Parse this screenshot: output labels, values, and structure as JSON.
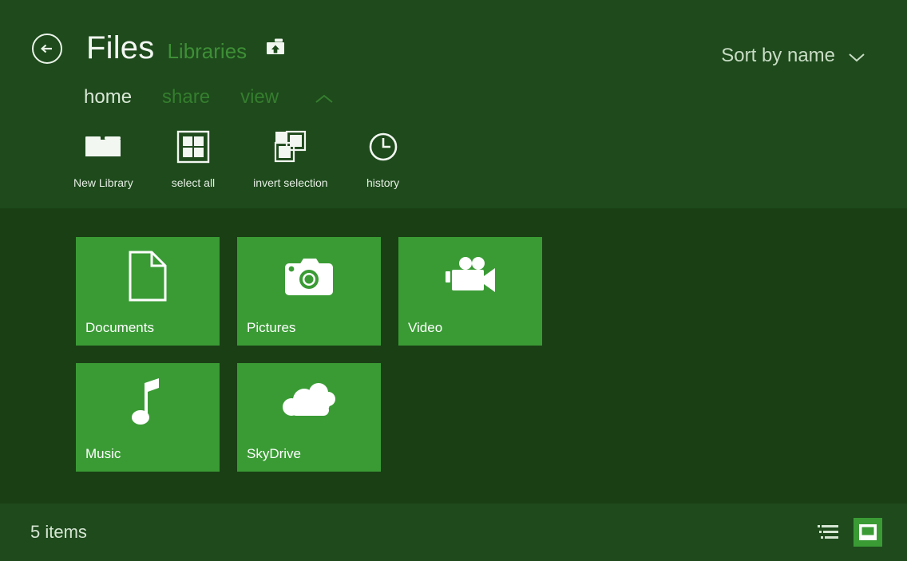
{
  "window": {
    "app_title": "Files",
    "breadcrumb_location": "Libraries",
    "back_icon": "back-arrow-circle-icon",
    "up_level_icon": "up-one-level-icon"
  },
  "sort": {
    "label": "Sort by name",
    "chevron_icon": "chevron-down-icon"
  },
  "tabs": [
    {
      "label": "home",
      "active": true
    },
    {
      "label": "share",
      "active": false
    },
    {
      "label": "view",
      "active": false
    }
  ],
  "ribbon_collapse_icon": "chevron-up-icon",
  "ribbon": {
    "commands": [
      {
        "label": "New Library",
        "icon": "folder-icon"
      },
      {
        "label": "select all",
        "icon": "select-all-grid-icon"
      },
      {
        "label": "invert selection",
        "icon": "invert-selection-icon"
      },
      {
        "label": "history",
        "icon": "clock-history-icon"
      }
    ]
  },
  "library_tiles": [
    {
      "label": "Documents",
      "icon": "document-page-icon"
    },
    {
      "label": "Pictures",
      "icon": "camera-icon"
    },
    {
      "label": "Video",
      "icon": "movie-camera-icon"
    },
    {
      "label": "Music",
      "icon": "music-note-icon"
    },
    {
      "label": "SkyDrive",
      "icon": "cloud-icon"
    }
  ],
  "statusbar": {
    "item_count": "5 items",
    "view_buttons": [
      {
        "icon": "details-list-view-icon",
        "active": false
      },
      {
        "icon": "large-icons-view-icon",
        "active": true
      }
    ]
  },
  "colors": {
    "header_bg": "#1e4a1c",
    "content_bg": "#1a3f15",
    "tile_green": "#3a9b35",
    "accent_text": "#3e8f36",
    "primary_text": "#f2f7f1"
  }
}
